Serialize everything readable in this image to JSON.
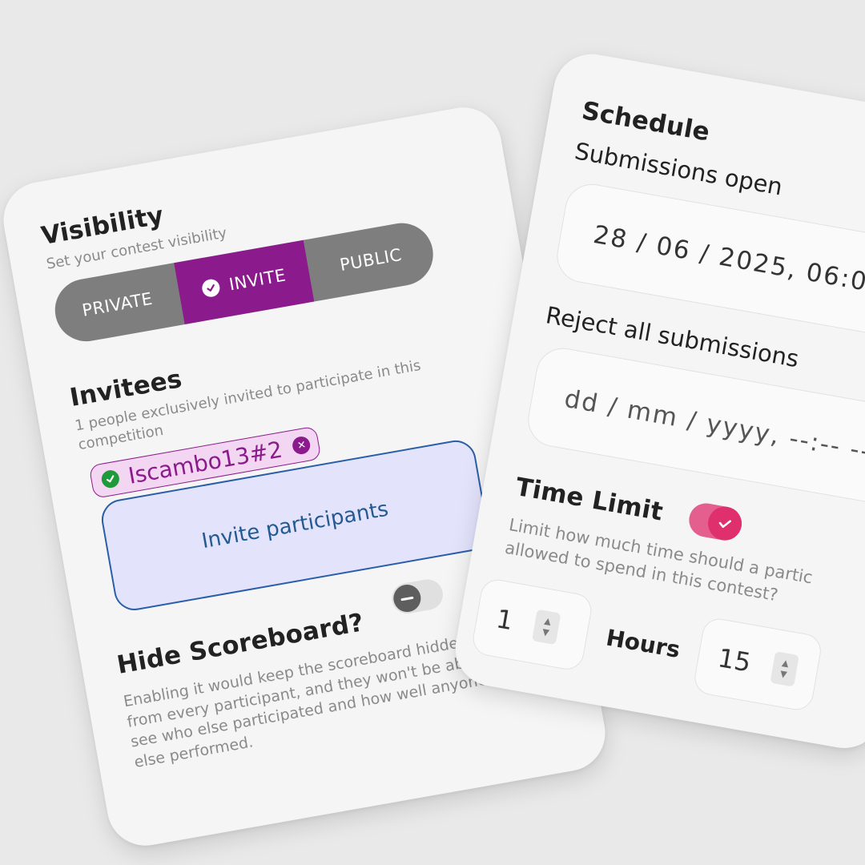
{
  "visibility": {
    "title": "Visibility",
    "subtitle": "Set your contest visibility",
    "options": [
      "PRIVATE",
      "INVITE",
      "PUBLIC"
    ],
    "selected": "INVITE",
    "accent_color": "#8b1b8d"
  },
  "invitees": {
    "title": "Invitees",
    "subtitle": "1 people exclusively invited to participate in this competition",
    "chips": [
      {
        "label": "Iscambo13#2"
      }
    ],
    "invite_button_label": "Invite participants"
  },
  "scoreboard": {
    "title": "Hide Scoreboard?",
    "toggle_state": "off",
    "description": "Enabling it would keep the scoreboard hidden from every participant, and they won't be able to see who else participated and how well anyone else performed."
  },
  "schedule": {
    "title": "Schedule",
    "open_label": "Submissions open",
    "open_value": "28 / 06 / 2025,  06:0",
    "reject_label": "Reject all submissions",
    "reject_placeholder": "dd / mm / yyyy,  --:--  --"
  },
  "time_limit": {
    "title": "Time Limit",
    "toggle_state": "on",
    "toggle_color": "#df2f6d",
    "description_line1": "Limit how much time should a partic",
    "description_line2": "allowed to spend in this contest?",
    "hours_value": "1",
    "hours_label": "Hours",
    "minutes_value": "15"
  }
}
